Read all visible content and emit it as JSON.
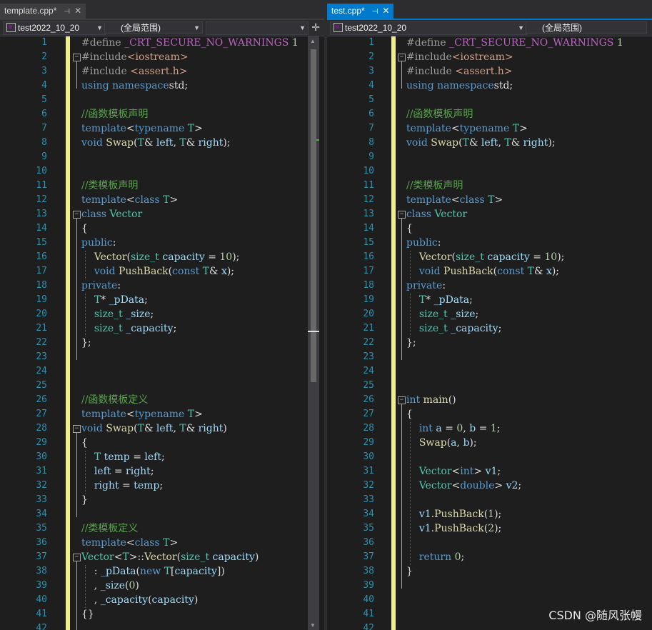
{
  "left": {
    "tab": {
      "title": "template.cpp*",
      "pin": "⊣",
      "close": "✕"
    },
    "project": "test2022_10_20",
    "scope": "(全局范围)",
    "lines": [
      [
        [
          "pp",
          "#define "
        ],
        [
          "mac",
          "_CRT_SECURE_NO_WARNINGS"
        ],
        [
          "pp",
          " "
        ],
        [
          "num",
          "1"
        ]
      ],
      [
        [
          "pp",
          "#include"
        ],
        [
          "str",
          "<iostream>"
        ]
      ],
      [
        [
          "pp",
          "#include "
        ],
        [
          "str",
          "<assert.h>"
        ]
      ],
      [
        [
          "kw",
          "using namespace"
        ],
        [
          "",
          "std;"
        ]
      ],
      [],
      [
        [
          "cm",
          "//函数模板声明"
        ]
      ],
      [
        [
          "kw",
          "template"
        ],
        [
          "",
          "<"
        ],
        [
          "kw",
          "typename"
        ],
        [
          "ty",
          " T"
        ],
        [
          "",
          ">"
        ]
      ],
      [
        [
          "kw",
          "void "
        ],
        [
          "fn",
          "Swap"
        ],
        [
          "",
          "("
        ],
        [
          "ty",
          "T"
        ],
        [
          "",
          "& "
        ],
        [
          "var",
          "left"
        ],
        [
          "",
          ", "
        ],
        [
          "ty",
          "T"
        ],
        [
          "",
          "& "
        ],
        [
          "var",
          "right"
        ],
        [
          "",
          ");"
        ]
      ],
      [],
      [],
      [
        [
          "cm",
          "//类模板声明"
        ]
      ],
      [
        [
          "kw",
          "template"
        ],
        [
          "",
          "<"
        ],
        [
          "kw",
          "class "
        ],
        [
          "ty",
          "T"
        ],
        [
          "",
          ">"
        ]
      ],
      [
        [
          "kw",
          "class "
        ],
        [
          "ty",
          "Vector"
        ]
      ],
      [
        [
          "",
          "{"
        ]
      ],
      [
        [
          "kw",
          "public"
        ],
        [
          "",
          ":"
        ]
      ],
      [
        [
          "",
          "    "
        ],
        [
          "fn",
          "Vector"
        ],
        [
          "",
          "("
        ],
        [
          "ty",
          "size_t"
        ],
        [
          "",
          ""
        ],
        [
          "var",
          " capacity"
        ],
        [
          "",
          " = "
        ],
        [
          "num",
          "10"
        ],
        [
          "",
          ");"
        ]
      ],
      [
        [
          "",
          "    "
        ],
        [
          "kw",
          "void "
        ],
        [
          "fn",
          "PushBack"
        ],
        [
          "",
          "("
        ],
        [
          "kw",
          "const "
        ],
        [
          "ty",
          "T"
        ],
        [
          "",
          "& "
        ],
        [
          "var",
          "x"
        ],
        [
          "",
          ");"
        ]
      ],
      [
        [
          "kw",
          "private"
        ],
        [
          "",
          ":"
        ]
      ],
      [
        [
          "",
          "    "
        ],
        [
          "ty",
          "T"
        ],
        [
          "",
          "* "
        ],
        [
          "var",
          "_pData"
        ],
        [
          "",
          ";"
        ]
      ],
      [
        [
          "",
          "    "
        ],
        [
          "ty",
          "size_t"
        ],
        [
          "var",
          " _size"
        ],
        [
          "",
          ";"
        ]
      ],
      [
        [
          "",
          "    "
        ],
        [
          "ty",
          "size_t"
        ],
        [
          "var",
          " _capacity"
        ],
        [
          "",
          ";"
        ]
      ],
      [
        [
          "",
          "};"
        ]
      ],
      [],
      [],
      [],
      [
        [
          "cm",
          "//函数模板定义"
        ]
      ],
      [
        [
          "kw",
          "template"
        ],
        [
          "",
          "<"
        ],
        [
          "kw",
          "typename"
        ],
        [
          "ty",
          " T"
        ],
        [
          "",
          ">"
        ]
      ],
      [
        [
          "kw",
          "void "
        ],
        [
          "fn",
          "Swap"
        ],
        [
          "",
          "("
        ],
        [
          "ty",
          "T"
        ],
        [
          "",
          "& "
        ],
        [
          "var",
          "left"
        ],
        [
          "",
          ", "
        ],
        [
          "ty",
          "T"
        ],
        [
          "",
          "& "
        ],
        [
          "var",
          "right"
        ],
        [
          "",
          ")"
        ]
      ],
      [
        [
          "",
          "{"
        ]
      ],
      [
        [
          "",
          "    "
        ],
        [
          "ty",
          "T"
        ],
        [
          "var",
          " temp"
        ],
        [
          "",
          " = "
        ],
        [
          "var",
          "left"
        ],
        [
          "",
          ";"
        ]
      ],
      [
        [
          "",
          "    "
        ],
        [
          "var",
          "left"
        ],
        [
          "",
          " = "
        ],
        [
          "var",
          "right"
        ],
        [
          "",
          ";"
        ]
      ],
      [
        [
          "",
          "    "
        ],
        [
          "var",
          "right"
        ],
        [
          "",
          " = "
        ],
        [
          "var",
          "temp"
        ],
        [
          "",
          ";"
        ]
      ],
      [
        [
          "",
          "}"
        ]
      ],
      [],
      [
        [
          "cm",
          "//类模板定义"
        ]
      ],
      [
        [
          "kw",
          "template"
        ],
        [
          "",
          "<"
        ],
        [
          "kw",
          "class "
        ],
        [
          "ty",
          "T"
        ],
        [
          "",
          ">"
        ]
      ],
      [
        [
          "ty",
          "Vector"
        ],
        [
          "",
          "<"
        ],
        [
          "ty",
          "T"
        ],
        [
          "",
          ">::"
        ],
        [
          "fn",
          "Vector"
        ],
        [
          "",
          "("
        ],
        [
          "ty",
          "size_t"
        ],
        [
          "var",
          " capacity"
        ],
        [
          "",
          ")"
        ]
      ],
      [
        [
          "",
          "    : "
        ],
        [
          "var",
          "_pData"
        ],
        [
          "",
          "("
        ],
        [
          "kw",
          "new "
        ],
        [
          "ty",
          "T"
        ],
        [
          "",
          "["
        ],
        [
          "var",
          "capacity"
        ],
        [
          "",
          "])"
        ]
      ],
      [
        [
          "",
          "    , "
        ],
        [
          "var",
          "_size"
        ],
        [
          "",
          "("
        ],
        [
          "num",
          "0"
        ],
        [
          "",
          ")"
        ]
      ],
      [
        [
          "",
          "    , "
        ],
        [
          "var",
          "_capacity"
        ],
        [
          "",
          "("
        ],
        [
          "var",
          "capacity"
        ],
        [
          "",
          ")"
        ]
      ],
      [
        [
          "",
          "{}"
        ]
      ],
      []
    ]
  },
  "right": {
    "tab": {
      "title": "test.cpp*",
      "pin": "⊣",
      "close": "✕"
    },
    "project": "test2022_10_20",
    "scope": "(全局范围)",
    "lines": [
      [
        [
          "pp",
          "#define "
        ],
        [
          "mac",
          "_CRT_SECURE_NO_WARNINGS"
        ],
        [
          "pp",
          " "
        ],
        [
          "num",
          "1"
        ]
      ],
      [
        [
          "pp",
          "#include"
        ],
        [
          "str",
          "<iostream>"
        ]
      ],
      [
        [
          "pp",
          "#include "
        ],
        [
          "str",
          "<assert.h>"
        ]
      ],
      [
        [
          "kw",
          "using namespace"
        ],
        [
          "",
          "std;"
        ]
      ],
      [],
      [
        [
          "cm",
          "//函数模板声明"
        ]
      ],
      [
        [
          "kw",
          "template"
        ],
        [
          "",
          "<"
        ],
        [
          "kw",
          "typename"
        ],
        [
          "ty",
          " T"
        ],
        [
          "",
          ">"
        ]
      ],
      [
        [
          "kw",
          "void "
        ],
        [
          "fn",
          "Swap"
        ],
        [
          "",
          "("
        ],
        [
          "ty",
          "T"
        ],
        [
          "",
          "& "
        ],
        [
          "var",
          "left"
        ],
        [
          "",
          ", "
        ],
        [
          "ty",
          "T"
        ],
        [
          "",
          "& "
        ],
        [
          "var",
          "right"
        ],
        [
          "",
          ");"
        ]
      ],
      [],
      [],
      [
        [
          "cm",
          "//类模板声明"
        ]
      ],
      [
        [
          "kw",
          "template"
        ],
        [
          "",
          "<"
        ],
        [
          "kw",
          "class "
        ],
        [
          "ty",
          "T"
        ],
        [
          "",
          ">"
        ]
      ],
      [
        [
          "kw",
          "class "
        ],
        [
          "ty",
          "Vector"
        ]
      ],
      [
        [
          "",
          "{"
        ]
      ],
      [
        [
          "kw",
          "public"
        ],
        [
          "",
          ":"
        ]
      ],
      [
        [
          "",
          "    "
        ],
        [
          "fn",
          "Vector"
        ],
        [
          "",
          "("
        ],
        [
          "ty",
          "size_t"
        ],
        [
          "var",
          " capacity"
        ],
        [
          "",
          " = "
        ],
        [
          "num",
          "10"
        ],
        [
          "",
          ");"
        ]
      ],
      [
        [
          "",
          "    "
        ],
        [
          "kw",
          "void "
        ],
        [
          "fn",
          "PushBack"
        ],
        [
          "",
          "("
        ],
        [
          "kw",
          "const "
        ],
        [
          "ty",
          "T"
        ],
        [
          "",
          "& "
        ],
        [
          "var",
          "x"
        ],
        [
          "",
          ");"
        ]
      ],
      [
        [
          "kw",
          "private"
        ],
        [
          "",
          ":"
        ]
      ],
      [
        [
          "",
          "    "
        ],
        [
          "ty",
          "T"
        ],
        [
          "",
          "* "
        ],
        [
          "var",
          "_pData"
        ],
        [
          "",
          ";"
        ]
      ],
      [
        [
          "",
          "    "
        ],
        [
          "ty",
          "size_t"
        ],
        [
          "var",
          " _size"
        ],
        [
          "",
          ";"
        ]
      ],
      [
        [
          "",
          "    "
        ],
        [
          "ty",
          "size_t"
        ],
        [
          "var",
          " _capacity"
        ],
        [
          "",
          ";"
        ]
      ],
      [
        [
          "",
          "};"
        ]
      ],
      [],
      [],
      [],
      [
        [
          "kw",
          "int "
        ],
        [
          "fn",
          "main"
        ],
        [
          "",
          "()"
        ]
      ],
      [
        [
          "",
          "{"
        ]
      ],
      [
        [
          "",
          "    "
        ],
        [
          "kw",
          "int "
        ],
        [
          "var",
          "a"
        ],
        [
          "",
          " = "
        ],
        [
          "num",
          "0"
        ],
        [
          "",
          ", "
        ],
        [
          "var",
          "b"
        ],
        [
          "",
          " = "
        ],
        [
          "num",
          "1"
        ],
        [
          "",
          ";"
        ]
      ],
      [
        [
          "",
          "    "
        ],
        [
          "fn",
          "Swap"
        ],
        [
          "",
          "("
        ],
        [
          "var",
          "a"
        ],
        [
          "",
          ", "
        ],
        [
          "var",
          "b"
        ],
        [
          "",
          ");"
        ]
      ],
      [],
      [
        [
          "",
          "    "
        ],
        [
          "ty",
          "Vector"
        ],
        [
          "",
          "<"
        ],
        [
          "kw",
          "int"
        ],
        [
          "",
          "> "
        ],
        [
          "var",
          "v1"
        ],
        [
          "",
          ";"
        ]
      ],
      [
        [
          "",
          "    "
        ],
        [
          "ty",
          "Vector"
        ],
        [
          "",
          "<"
        ],
        [
          "kw",
          "double"
        ],
        [
          "",
          "> "
        ],
        [
          "var",
          "v2"
        ],
        [
          "",
          ";"
        ]
      ],
      [],
      [
        [
          "",
          "    "
        ],
        [
          "var",
          "v1"
        ],
        [
          "",
          "."
        ],
        [
          "fn",
          "PushBack"
        ],
        [
          "",
          "("
        ],
        [
          "num",
          "1"
        ],
        [
          "",
          ");"
        ]
      ],
      [
        [
          "",
          "    "
        ],
        [
          "var",
          "v1"
        ],
        [
          "",
          "."
        ],
        [
          "fn",
          "PushBack"
        ],
        [
          "",
          "("
        ],
        [
          "num",
          "2"
        ],
        [
          "",
          ");"
        ]
      ],
      [],
      [
        [
          "",
          "    "
        ],
        [
          "kw",
          "return "
        ],
        [
          "num",
          "0"
        ],
        [
          "",
          ";"
        ]
      ],
      [
        [
          "",
          "}"
        ]
      ],
      [],
      [],
      [],
      []
    ]
  },
  "watermark": "CSDN @随风张幔"
}
